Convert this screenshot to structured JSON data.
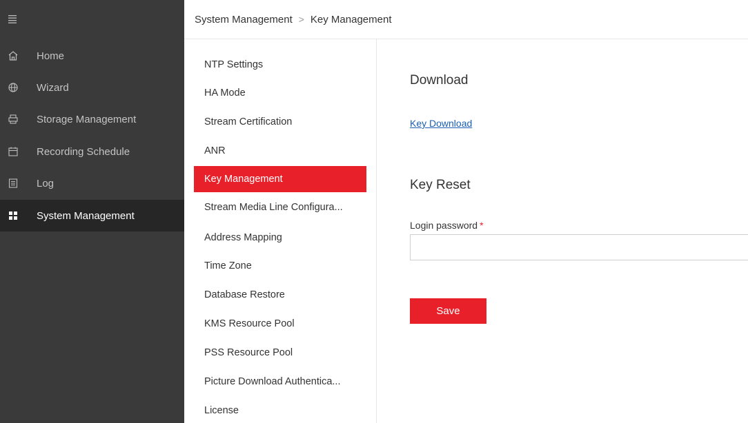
{
  "nav": {
    "toggle_icon": "hamburger-icon",
    "items": [
      {
        "label": "Home",
        "icon": "home-icon"
      },
      {
        "label": "Wizard",
        "icon": "globe-icon"
      },
      {
        "label": "Storage Management",
        "icon": "storage-icon"
      },
      {
        "label": "Recording Schedule",
        "icon": "calendar-icon"
      },
      {
        "label": "Log",
        "icon": "log-icon"
      },
      {
        "label": "System Management",
        "icon": "grid-icon",
        "active": true
      }
    ]
  },
  "breadcrumb": {
    "parent": "System Management",
    "separator": ">",
    "current": "Key Management"
  },
  "submenu": {
    "items": [
      "NTP Settings",
      "HA Mode",
      "Stream Certification",
      "ANR",
      "Key Management",
      "Stream Media Line Configura...",
      "Address Mapping",
      "Time Zone",
      "Database Restore",
      "KMS Resource Pool",
      "PSS Resource Pool",
      "Picture Download Authentica...",
      "License"
    ],
    "active": "Key Management"
  },
  "content": {
    "download_title": "Download",
    "download_link": "Key Download",
    "reset_title": "Key Reset",
    "password_label": "Login password",
    "required_mark": "*",
    "password_value": "",
    "save_label": "Save"
  },
  "colors": {
    "accent": "#e8202a",
    "nav_bg": "#3a3a3a",
    "nav_active_bg": "#262626",
    "link": "#1a5fb4"
  }
}
